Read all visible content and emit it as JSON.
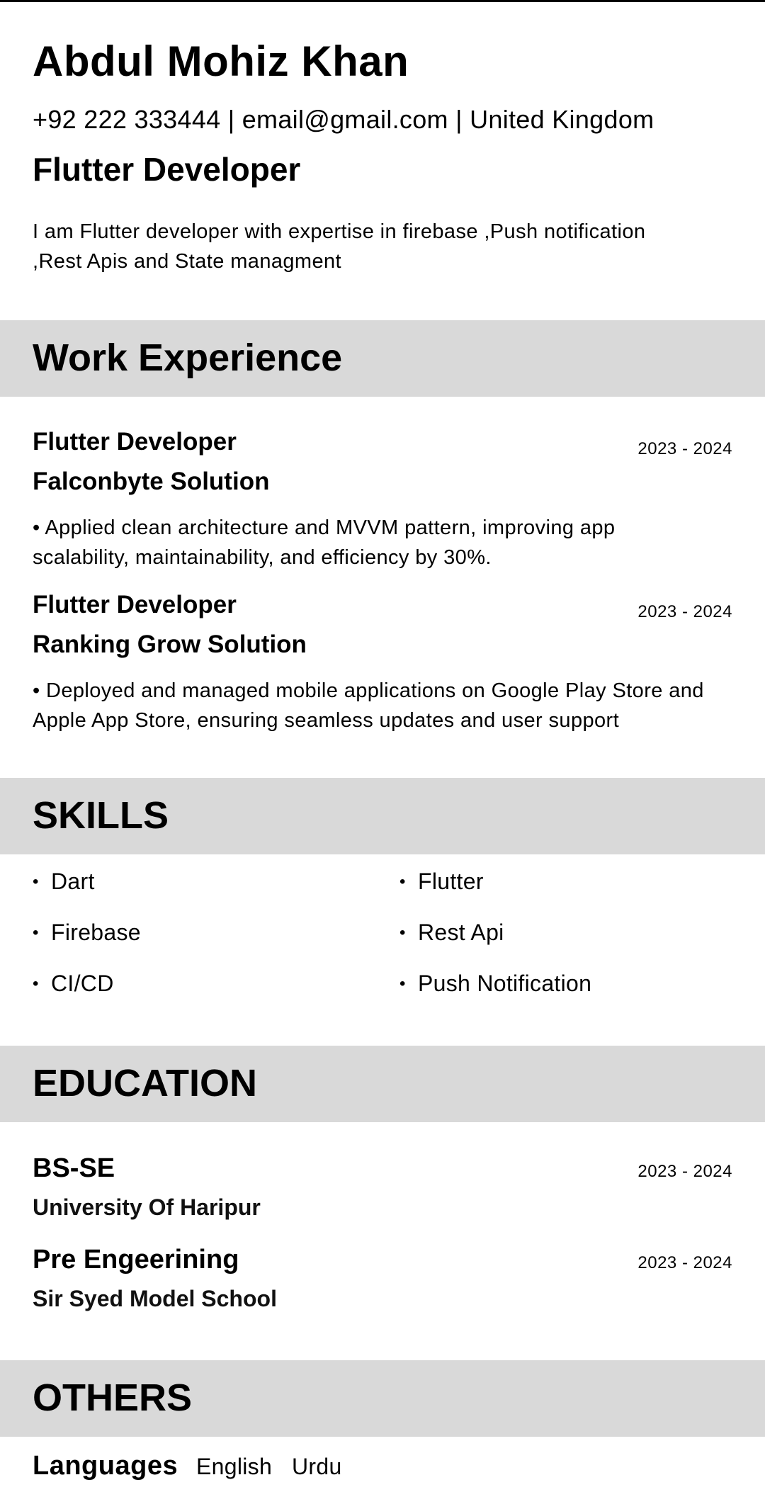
{
  "header": {
    "name": "Abdul Mohiz Khan",
    "contact": "+92 222 333444 | email@gmail.com | United Kingdom",
    "role": "Flutter Developer",
    "summary": "I am Flutter developer with expertise in firebase ,Push notification ,Rest Apis and State managment"
  },
  "work": {
    "title": "Work Experience",
    "items": [
      {
        "position": "Flutter Developer",
        "company": "Falconbyte Solution",
        "dates": "2023 - 2024",
        "description": "• Applied clean architecture and MVVM pattern, improving app scalability, maintainability, and efficiency by 30%."
      },
      {
        "position": "Flutter Developer",
        "company": "Ranking Grow Solution",
        "dates": "2023 - 2024",
        "description": "• Deployed and managed mobile applications on Google Play Store and Apple App Store, ensuring seamless updates and user support"
      }
    ]
  },
  "skills": {
    "title": "SKILLS",
    "bullet": "•",
    "items": [
      "Dart",
      "Flutter",
      "Firebase",
      "Rest Api",
      "CI/CD",
      "Push Notification"
    ]
  },
  "education": {
    "title": "EDUCATION",
    "items": [
      {
        "degree": "BS-SE",
        "school": "University Of Haripur",
        "dates": "2023 - 2024"
      },
      {
        "degree": "Pre Engeerining",
        "school": "Sir Syed Model School",
        "dates": "2023 - 2024"
      }
    ]
  },
  "others": {
    "title": "OTHERS",
    "languages_label": "Languages",
    "languages": [
      "English",
      "Urdu"
    ]
  }
}
